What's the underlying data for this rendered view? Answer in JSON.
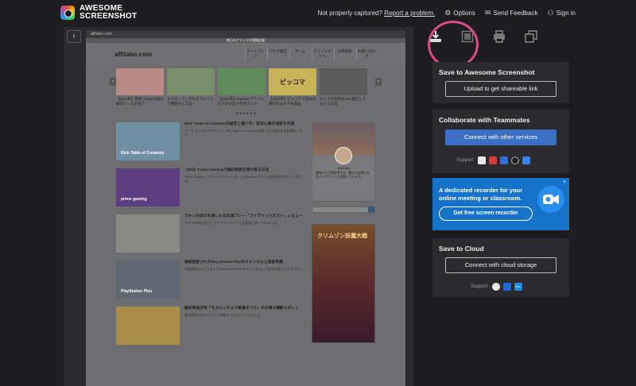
{
  "brand": {
    "line1": "AWESOME",
    "line2": "SCREENSHOT"
  },
  "nav": {
    "not_captured": "Not properly captured?",
    "report": "Report a problem.",
    "options": "Options",
    "feedback": "Send Feedback",
    "signin": "Sign in"
  },
  "preview": {
    "back": "‹",
    "browser_url": "affilabo.com",
    "subbar": "毎日のアフィリの実践記録",
    "site_logo": "affilabo.com",
    "menu": [
      "ワードプレス",
      "ブログ運営",
      "ゲーム",
      "アフィリエイト",
      "お得情報",
      "お問い合わせ"
    ],
    "carousel": [
      {
        "cap": "【2022年】夜更けSNSの組む無料ツールを紹介",
        "color": "#b88a86"
      },
      {
        "cap": "エヌガーリングのカラエインで徹底ひく方法",
        "color": "#7a8f6e"
      },
      {
        "cap": "【2022年】Amazonプライムビデオのおすすめアニメ",
        "color": "#5f8a5a"
      },
      {
        "cap": "【2022年】ピッコマで読める無料のおすすめ漫画",
        "color": "#c9b35a"
      },
      {
        "cap": "カメラの有料を10%還元してもらう方法",
        "color": "#5a5a5a"
      }
    ],
    "carousel_badge": "ピッコマ",
    "dots": "● ● ● ● ● ●",
    "posts": [
      {
        "thumb": "Rich Table of Contents",
        "color": "#6f8fa3",
        "title": "Rich Table of Contentsの設定と使い方：目次に表示項目を作成",
        "desc": "ワードプレスのプラグイン、Rich Table of Contentsの使い方と設定方法を解説します。"
      },
      {
        "thumb": "prime gaming",
        "color": "#5b3d80",
        "title": "【3/2】Prime Gamingで無料特典を受け取る方法",
        "desc": "Prime Gaming（プライムゲーミング）とはAmazonプライム会員向けのサービスです。"
      },
      {
        "thumb": "",
        "color": "#8a8a84",
        "title": "ラオンの前のを楽しむ日本酒ブレー「ファブリックガスト」レビュー",
        "desc": "ラオンの前を楽しむファブリックガストを実際に使ってみました。"
      },
      {
        "thumb": "PlayStation Plus",
        "color": "#5f6770",
        "title": "継続更新されたPlayStation Plusのキャンセルと返金申請",
        "desc": "自動更新されてしまったPlayStation Plusをキャンセルして返金申請した方法です。"
      },
      {
        "thumb": "",
        "color": "#a98e4a",
        "title": "愛知県稲沢市『そぶえイチョウ黄葉まつり』の日帰り撮影スポット",
        "desc": "愛知県稲沢市のイチョウ黄葉まつりに行ってきました。"
      }
    ],
    "profile": {
      "name": "Suzuka",
      "desc": "趣味ブログ運営中です。積立を投資するガイドアフィリで活動しています。"
    },
    "ad": {
      "title": "クリムゾン妖魔大戦"
    }
  },
  "tools": {
    "download": "download-icon",
    "copy_edit": "edit-icon",
    "print": "print-icon",
    "copy": "copy-icon"
  },
  "save_panel": {
    "title": "Save to Awesome Screenshot",
    "button": "Upload to get shareable link"
  },
  "collab_panel": {
    "title": "Collaborate with Teammates",
    "button": "Connect with other services",
    "support": "Support:"
  },
  "promo": {
    "line1": "A dedicated recorder for your",
    "line2": "online meeting or classroom.",
    "button": "Get free screen recorder",
    "close": "×"
  },
  "cloud_panel": {
    "title": "Save to Cloud",
    "button": "Connect with cloud storage",
    "support": "Support:"
  },
  "colors": {
    "accent": "#3a6fc5",
    "highlight_ring": "#e04a8a",
    "promo_bg": "#1773c9"
  }
}
